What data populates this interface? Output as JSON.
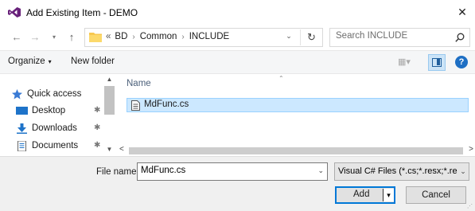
{
  "window": {
    "title": "Add Existing Item - DEMO",
    "app_icon": "visual-studio-icon",
    "close_label": "✕"
  },
  "address": {
    "back_icon": "←",
    "forward_icon": "→",
    "recent_icon": "▾",
    "up_icon": "↑",
    "overflow": "«",
    "crumbs": [
      "BD",
      "Common",
      "INCLUDE"
    ],
    "separator": "›",
    "dropdown_icon": "⌄",
    "refresh_icon": "↻"
  },
  "search": {
    "placeholder": "Search INCLUDE",
    "icon": "search-icon"
  },
  "commandbar": {
    "organize_label": "Organize",
    "organize_caret": "▾",
    "new_folder_label": "New folder",
    "view_icon": "▦▾",
    "help_label": "?"
  },
  "navpane": {
    "items": [
      {
        "label": "Quick access",
        "icon": "star-icon",
        "pinned": false
      },
      {
        "label": "Desktop",
        "icon": "desktop-icon",
        "pinned": true
      },
      {
        "label": "Downloads",
        "icon": "download-icon",
        "pinned": true
      },
      {
        "label": "Documents",
        "icon": "documents-icon",
        "pinned": true
      }
    ],
    "pin_glyph": "✱",
    "scroll_up": "▲",
    "scroll_down": "▼"
  },
  "filelist": {
    "column_name": "Name",
    "sort_glyph": "⌃",
    "files": [
      {
        "name": "MdFunc.cs",
        "selected": true
      }
    ],
    "scroll_left": "<",
    "scroll_right": ">"
  },
  "footer": {
    "file_name_label": "File name:",
    "file_name_value": "MdFunc.cs",
    "file_name_dd": "⌄",
    "file_type_value": "Visual C# Files (*.cs;*.resx;*.resw",
    "file_type_dd": "⌄",
    "add_label": "Add",
    "add_split": "▾",
    "cancel_label": "Cancel",
    "grip": "⋰"
  },
  "colors": {
    "accent": "#0078d7",
    "selection": "#cce8ff",
    "help": "#1e6fc4",
    "folder": "#f7c850"
  }
}
